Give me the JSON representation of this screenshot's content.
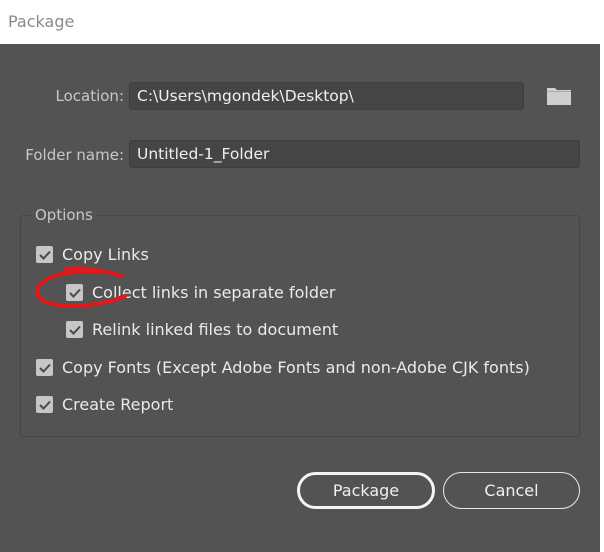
{
  "dialog": {
    "title": "Package"
  },
  "location": {
    "label": "Location:",
    "value": "C:\\Users\\mgondek\\Desktop\\"
  },
  "folder_name": {
    "label": "Folder name:",
    "value": "Untitled-1_Folder"
  },
  "options": {
    "heading": "Options",
    "items": [
      {
        "label": "Copy Links",
        "checked": true
      },
      {
        "label": "Collect links in separate folder",
        "checked": true
      },
      {
        "label": "Relink linked files to document",
        "checked": true
      },
      {
        "label": "Copy Fonts (Except Adobe Fonts and non-Adobe CJK fonts)",
        "checked": true
      },
      {
        "label": "Create Report",
        "checked": true
      }
    ]
  },
  "buttons": {
    "package": "Package",
    "cancel": "Cancel"
  },
  "colors": {
    "annotation": "#e0191c",
    "background": "#535353"
  }
}
